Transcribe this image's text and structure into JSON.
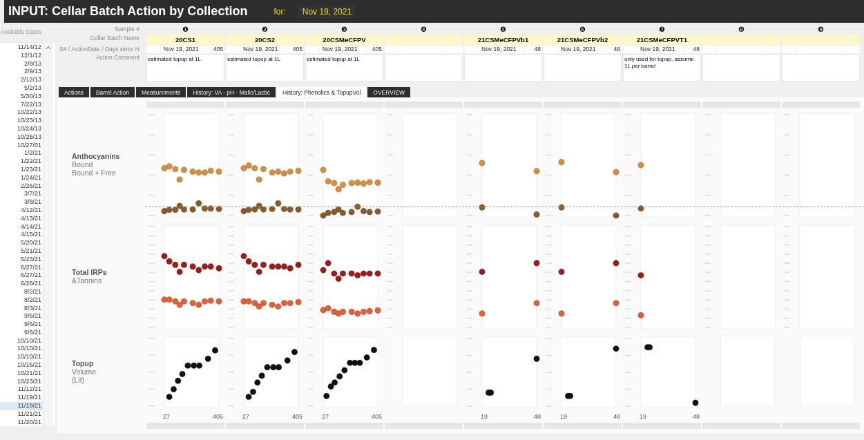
{
  "header": {
    "title": "INPUT: Cellar Batch Action by Collection",
    "for_label": "for:",
    "date": "Nov 19, 2021"
  },
  "dates_panel": {
    "heading": "Available Dates",
    "items": [
      {
        "label": "11/14/12",
        "selected": false
      },
      {
        "label": "12/1/12",
        "selected": false
      },
      {
        "label": "2/8/13",
        "selected": false
      },
      {
        "label": "2/9/13",
        "selected": false
      },
      {
        "label": "2/12/13",
        "selected": false
      },
      {
        "label": "5/2/13",
        "selected": false
      },
      {
        "label": "5/30/13",
        "selected": false
      },
      {
        "label": "7/22/13",
        "selected": false
      },
      {
        "label": "10/22/13",
        "selected": false
      },
      {
        "label": "10/23/13",
        "selected": false
      },
      {
        "label": "10/24/13",
        "selected": false
      },
      {
        "label": "10/25/13",
        "selected": false
      },
      {
        "label": "10/27/01",
        "selected": false
      },
      {
        "label": "1/2/21",
        "selected": false
      },
      {
        "label": "1/22/21",
        "selected": false
      },
      {
        "label": "1/23/21",
        "selected": false
      },
      {
        "label": "1/24/21",
        "selected": false
      },
      {
        "label": "2/26/21",
        "selected": false
      },
      {
        "label": "3/7/21",
        "selected": false
      },
      {
        "label": "3/8/21",
        "selected": false
      },
      {
        "label": "4/12/21",
        "selected": false
      },
      {
        "label": "4/13/21",
        "selected": false
      },
      {
        "label": "4/14/21",
        "selected": false
      },
      {
        "label": "4/15/21",
        "selected": false
      },
      {
        "label": "5/20/21",
        "selected": false
      },
      {
        "label": "5/21/21",
        "selected": false
      },
      {
        "label": "5/23/21",
        "selected": false
      },
      {
        "label": "6/27/21",
        "selected": false
      },
      {
        "label": "6/27/21",
        "selected": false
      },
      {
        "label": "6/28/21",
        "selected": false
      },
      {
        "label": "8/2/21",
        "selected": false
      },
      {
        "label": "8/2/21",
        "selected": false
      },
      {
        "label": "8/3/21",
        "selected": false
      },
      {
        "label": "9/6/21",
        "selected": false
      },
      {
        "label": "9/6/21",
        "selected": false
      },
      {
        "label": "9/6/21",
        "selected": false
      },
      {
        "label": "10/10/21",
        "selected": false
      },
      {
        "label": "10/10/21",
        "selected": false
      },
      {
        "label": "10/10/21",
        "selected": false
      },
      {
        "label": "10/16/21",
        "selected": false
      },
      {
        "label": "10/21/21",
        "selected": false
      },
      {
        "label": "10/23/21",
        "selected": false
      },
      {
        "label": "11/12/21",
        "selected": false
      },
      {
        "label": "11/19/21",
        "selected": false
      },
      {
        "label": "11/19/21",
        "selected": true
      },
      {
        "label": "11/21/21",
        "selected": false
      },
      {
        "label": "11/20/21",
        "selected": false
      }
    ]
  },
  "form_labels": [
    "Sample #",
    "Cellar Batch Name",
    "S# / ActionDate / Days since H",
    "Action Comment"
  ],
  "tabs": [
    {
      "label": "Actions",
      "selected": false
    },
    {
      "label": "Barrel Action",
      "selected": false
    },
    {
      "label": "Measurements",
      "selected": false
    },
    {
      "label": "History: VA - pH - Malic/Lactic",
      "selected": false
    },
    {
      "label": "History: Phenolics & TopupVol",
      "selected": true
    },
    {
      "label": "OVERVIEW",
      "selected": false
    }
  ],
  "chart_rows": [
    {
      "title": "Anthocyanins",
      "lines": [
        "Bound",
        "Bound + Free"
      ]
    },
    {
      "title": "Total IRPs",
      "lines": [
        "&Tannins"
      ]
    },
    {
      "title": "Topup",
      "lines": [
        "Volume",
        "(Lit)"
      ]
    }
  ],
  "samples": [
    {
      "number": "❶",
      "batch_name": "20CS1",
      "action_date": "Nov 19, 2021",
      "days": "405",
      "comment": "estimated topup at 1L",
      "plots": [
        {
          "kind": "points"
        },
        {
          "kind": "points"
        },
        {
          "kind": "points"
        }
      ],
      "x_labels": [
        "27",
        "405"
      ]
    },
    {
      "number": "❷",
      "batch_name": "20CS2",
      "action_date": "Nov 19, 2021",
      "days": "405",
      "comment": "estimated topup at 1L",
      "plots": [
        {
          "kind": "points"
        },
        {
          "kind": "points"
        },
        {
          "kind": "points"
        }
      ],
      "x_labels": [
        "27",
        "405"
      ]
    },
    {
      "number": "❸",
      "batch_name": "20CSMeCFPV",
      "action_date": "Nov 19, 2021",
      "days": "405",
      "comment": "estimated topup at 1L",
      "plots": [
        {
          "kind": "points"
        },
        {
          "kind": "points"
        },
        {
          "kind": "points"
        }
      ],
      "x_labels": [
        "27",
        "405"
      ]
    },
    {
      "number": "❹",
      "plots": [
        {
          "kind": "axes"
        },
        {
          "kind": "axes"
        },
        {
          "kind": "blank"
        }
      ]
    },
    {
      "number": "❺",
      "batch_name": "21CSMeCFPVb1",
      "action_date": "Nov 19, 2021",
      "days": "48",
      "plots": [
        {
          "kind": "points"
        },
        {
          "kind": "points"
        },
        {
          "kind": "points"
        }
      ],
      "x_labels": [
        "19",
        "48"
      ]
    },
    {
      "number": "❻",
      "batch_name": "21CSMeCFPVb2",
      "action_date": "Nov 19, 2021",
      "days": "48",
      "plots": [
        {
          "kind": "points"
        },
        {
          "kind": "points"
        },
        {
          "kind": "points"
        }
      ],
      "x_labels": [
        "19",
        "48"
      ]
    },
    {
      "number": "❼",
      "batch_name": "21CSMeCFPVT1",
      "action_date": "Nov 19, 2021",
      "days": "48",
      "comment": "only used for topup, assume 1L per barrel",
      "plots": [
        {
          "kind": "points"
        },
        {
          "kind": "points"
        },
        {
          "kind": "points"
        }
      ],
      "x_labels": [
        "19",
        "48"
      ]
    },
    {
      "number": "❽",
      "plots": [
        {
          "kind": "axes"
        },
        {
          "kind": "axes"
        },
        {
          "kind": "blank"
        }
      ]
    },
    {
      "number": "❾",
      "plots": [
        {
          "kind": "axes"
        },
        {
          "kind": "axes"
        },
        {
          "kind": "blank"
        }
      ]
    }
  ]
}
